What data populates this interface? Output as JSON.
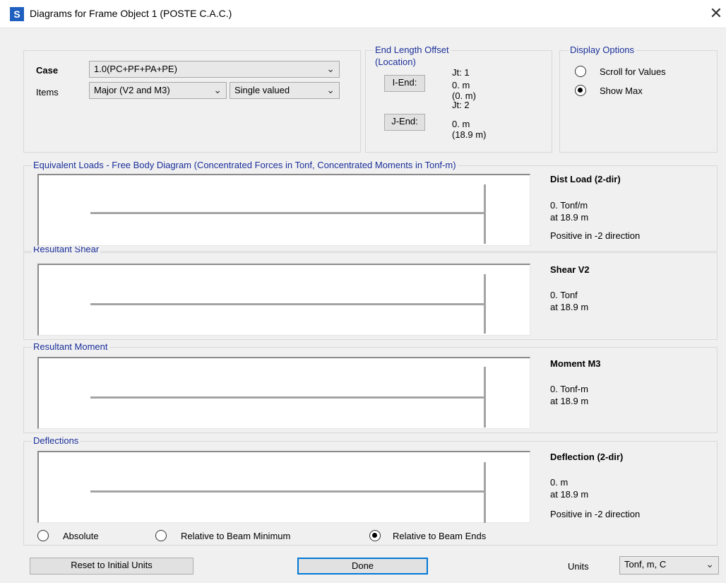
{
  "window": {
    "title": "Diagrams for Frame Object 1  (POSTE C.A.C.)",
    "app_icon_letter": "S",
    "close_glyph": "✕"
  },
  "case_group": {
    "case_label": "Case",
    "case_value": "1.0(PC+PF+PA+PE)",
    "items_label": "Items",
    "items_value": "Major (V2 and M3)",
    "mode_value": "Single valued"
  },
  "end_length_offset": {
    "title_line1": "End Length Offset",
    "title_line2": "(Location)",
    "i_end_button": "I-End:",
    "j_end_button": "J-End:",
    "i_joint": "Jt:  1",
    "i_offset": "0. m",
    "i_location": "(0. m)",
    "j_joint": "Jt:  2",
    "j_offset": "0. m",
    "j_location": "(18.9 m)"
  },
  "display_options": {
    "title": "Display Options",
    "option_scroll": "Scroll for Values",
    "option_show_max": "Show Max",
    "selected": "Show Max"
  },
  "sections": {
    "equivalent_loads": {
      "title": "Equivalent Loads - Free Body Diagram  (Concentrated Forces in Tonf, Concentrated Moments in Tonf-m)",
      "heading": "Dist Load (2-dir)",
      "value": "0. Tonf/m",
      "location": "at 18.9 m",
      "note": "Positive in -2 direction"
    },
    "shear": {
      "title": "Resultant Shear",
      "heading": "Shear V2",
      "value": "0. Tonf",
      "location": "at 18.9 m"
    },
    "moment": {
      "title": "Resultant Moment",
      "heading": "Moment M3",
      "value": "0. Tonf-m",
      "location": "at 18.9 m"
    },
    "deflections": {
      "title": "Deflections",
      "heading": "Deflection (2-dir)",
      "value": "0. m",
      "location": "at 18.9 m",
      "note": "Positive in -2 direction"
    }
  },
  "deflection_mode": {
    "absolute": "Absolute",
    "relative_min": "Relative to Beam Minimum",
    "relative_ends": "Relative to Beam Ends",
    "selected": "Relative to Beam Ends"
  },
  "footer": {
    "reset_button": "Reset to Initial Units",
    "done_button": "Done",
    "units_label": "Units",
    "units_value": "Tonf, m, C"
  },
  "icons": {
    "dropdown": "chevron-down-icon",
    "close": "close-icon"
  },
  "colors": {
    "group_title": "#1a2f9a",
    "focus_border": "#0078d7",
    "diagram_line": "#a4a4a4",
    "app_icon": "#1f5fbf"
  }
}
